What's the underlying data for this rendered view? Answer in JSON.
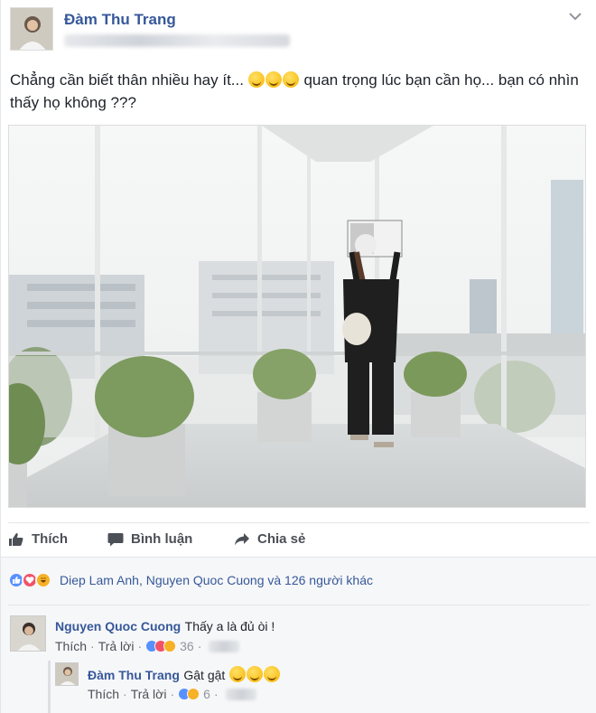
{
  "post": {
    "author": "Đàm Thu Trang",
    "caption_part1": "Chẳng cần biết thân nhiều hay ít...",
    "caption_part2": "quan trọng lúc bạn cần họ... bạn có nhìn thấy họ không ???",
    "caption_emoji_count": 3
  },
  "actions": {
    "like": "Thích",
    "comment": "Bình luận",
    "share": "Chia sẻ"
  },
  "reactions": {
    "types": [
      "like-icon",
      "love-icon",
      "haha-icon"
    ],
    "summary": "Diep Lam Anh, Nguyen Quoc Cuong và 126 người khác"
  },
  "comments": [
    {
      "author": "Nguyen Quoc Cuong",
      "text": "Thấy a là đủ òi !",
      "like_label": "Thích",
      "reply_label": "Trả lời",
      "reaction_count": "36",
      "separator": "·"
    }
  ],
  "replies": [
    {
      "author": "Đàm Thu Trang",
      "text": "Gật gật",
      "like_label": "Thích",
      "reply_label": "Trả lời",
      "reaction_count": "6",
      "separator": "·"
    }
  ],
  "colors": {
    "link_blue": "#365899",
    "meta_gray": "#90949c",
    "like_blue": "#5890ff",
    "love_red": "#f25268",
    "haha_yellow": "#f7b125"
  }
}
